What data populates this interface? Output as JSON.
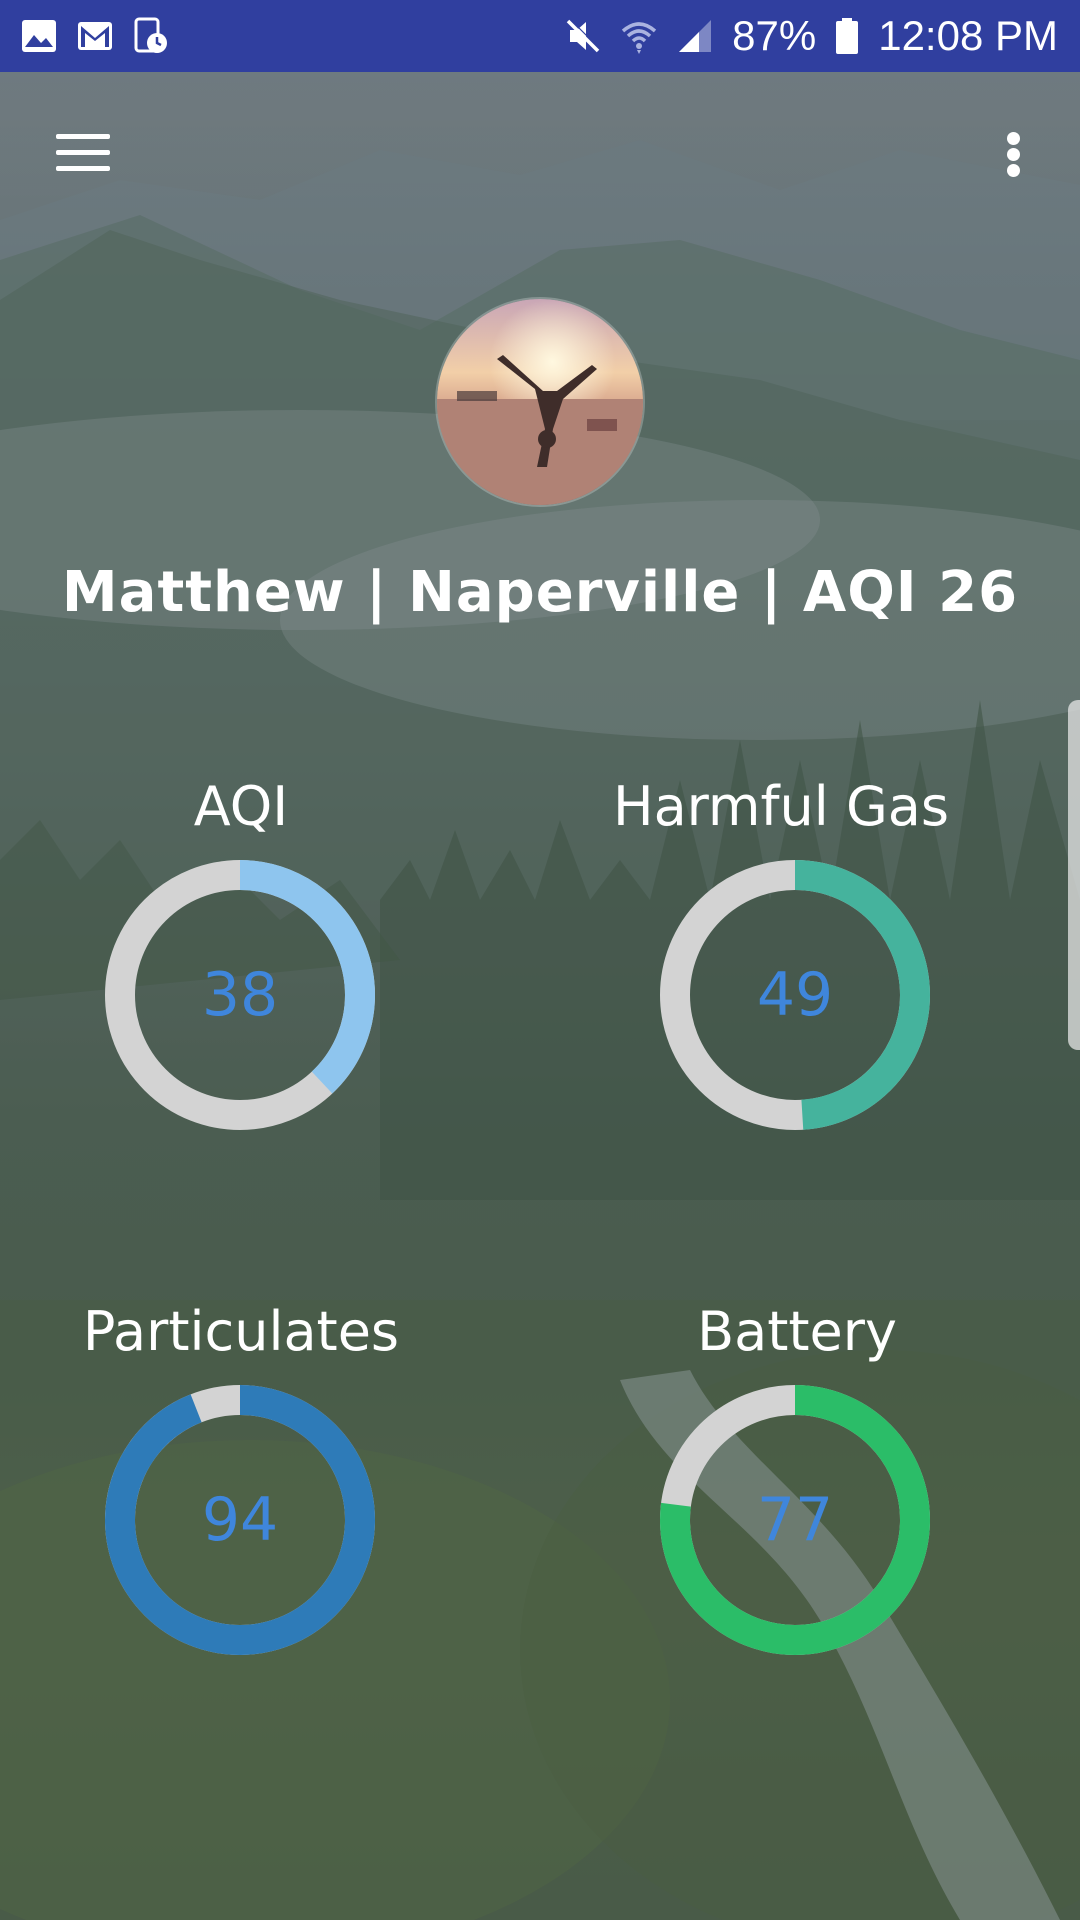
{
  "status_bar": {
    "battery_text": "87%",
    "time": "12:08 PM",
    "left_icons": [
      "gallery-icon",
      "gmail-icon",
      "device-clock-icon"
    ],
    "right_icons": [
      "mute-icon",
      "wifi-icon",
      "signal-icon",
      "battery-icon"
    ]
  },
  "toolbar": {
    "menu_icon": "hamburger-menu-icon",
    "overflow_icon": "more-vertical-icon"
  },
  "headline": "Matthew |  Naperville | AQI 26",
  "gauges": [
    {
      "label": "AQI",
      "value": "38",
      "percent": 38,
      "color": "#8ec5ee"
    },
    {
      "label": "Harmful Gas",
      "value": "49",
      "percent": 49,
      "color": "#45b39d"
    },
    {
      "label": "Particulates",
      "value": "94",
      "percent": 94,
      "color": "#2e7bb8"
    },
    {
      "label": "Battery",
      "value": "77",
      "percent": 77,
      "color": "#2bbd68"
    }
  ],
  "colors": {
    "status_bar": "#303f9f",
    "track": "#d3d3d3",
    "value_text": "#3f86dc"
  }
}
